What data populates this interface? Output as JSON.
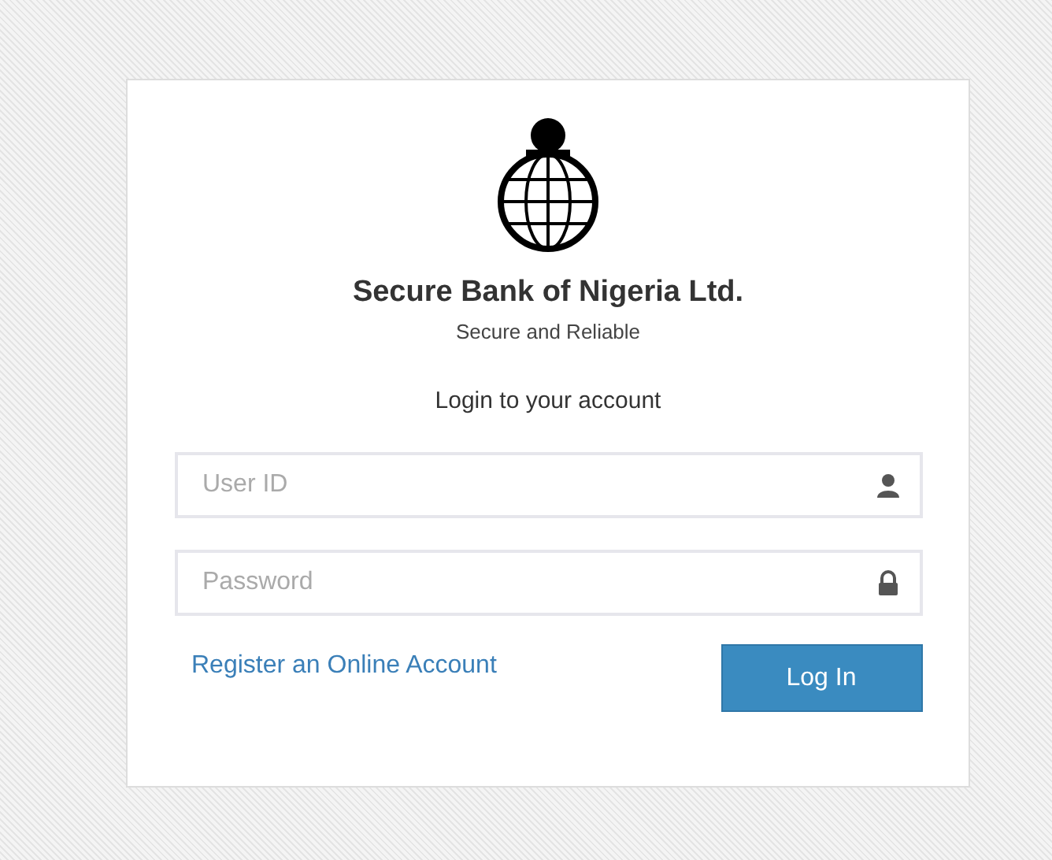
{
  "brand": {
    "name": "Secure Bank of Nigeria Ltd.",
    "tagline": "Secure and Reliable"
  },
  "heading": "Login to your account",
  "fields": [
    {
      "kind": "user",
      "placeholder": "User ID"
    },
    {
      "kind": "password",
      "placeholder": "Password"
    }
  ],
  "register_link": "Register an Online Account",
  "login_button": "Log In"
}
